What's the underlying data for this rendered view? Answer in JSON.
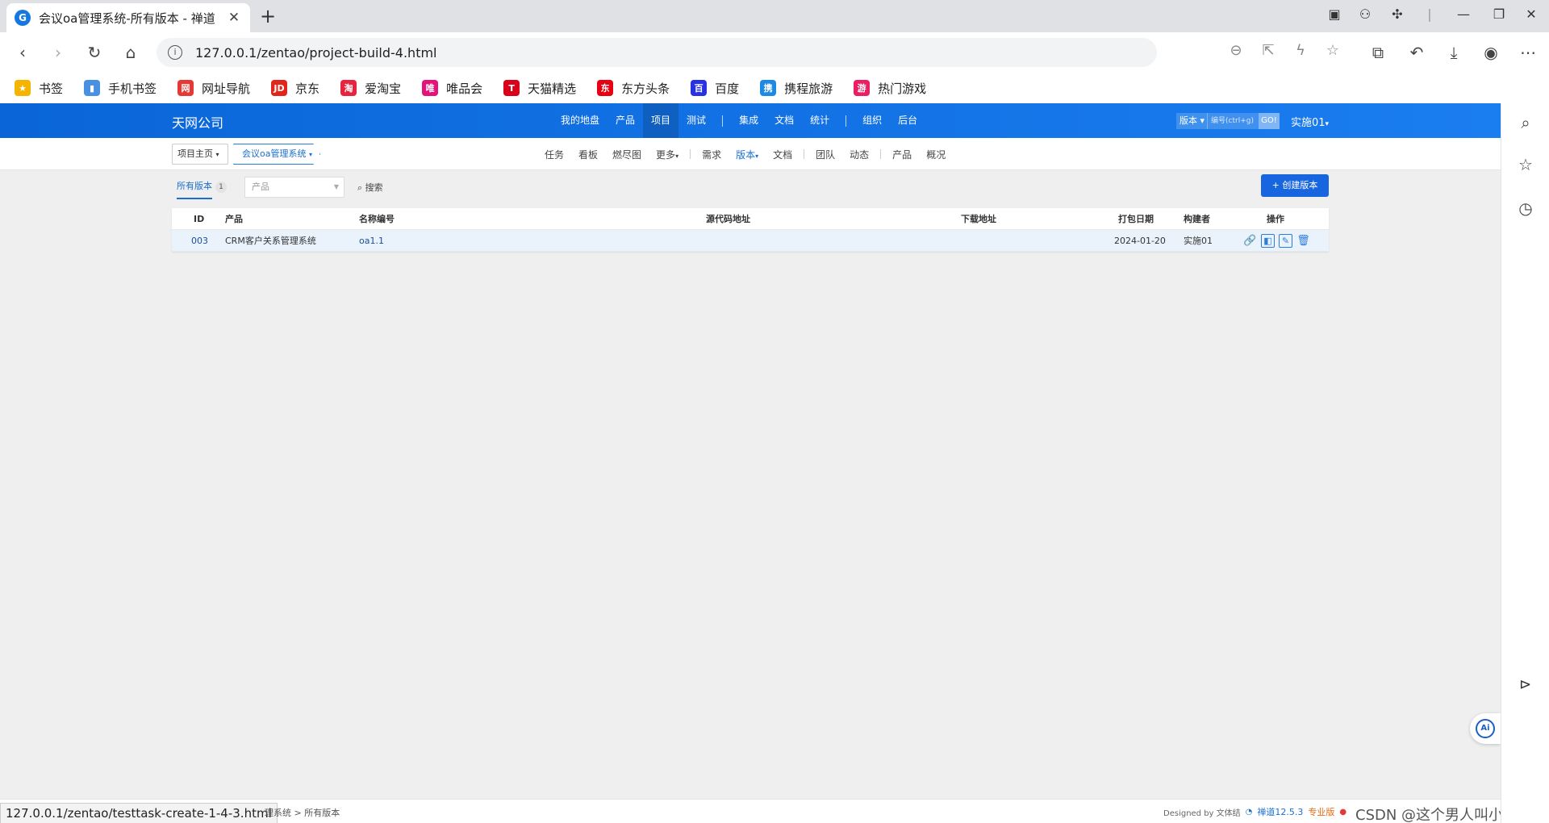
{
  "browser": {
    "tab_title": "会议oa管理系统-所有版本 - 禅道",
    "tab_close": "✕",
    "favicon_letter": "G",
    "new_tab": "+",
    "url": "127.0.0.1/zentao/project-build-4.html",
    "info_glyph": "i",
    "bookmarks": [
      {
        "label": "书签",
        "icon": "star-icon",
        "color": "#f5b400",
        "glyph": "★"
      },
      {
        "label": "手机书签",
        "icon": "phone-icon",
        "color": "#4a90e2",
        "glyph": "▮"
      },
      {
        "label": "网址导航",
        "icon": "nav-icon",
        "color": "#e53935",
        "glyph": "网"
      },
      {
        "label": "京东",
        "icon": "jd-icon",
        "color": "#e1251b",
        "glyph": "JD"
      },
      {
        "label": "爱淘宝",
        "icon": "taobao-icon",
        "color": "#e8233f",
        "glyph": "淘"
      },
      {
        "label": "唯品会",
        "icon": "vip-icon",
        "color": "#e2147a",
        "glyph": "唯"
      },
      {
        "label": "天猫精选",
        "icon": "tmall-icon",
        "color": "#d9001b",
        "glyph": "T"
      },
      {
        "label": "东方头条",
        "icon": "dongfang-icon",
        "color": "#e60012",
        "glyph": "东"
      },
      {
        "label": "百度",
        "icon": "baidu-icon",
        "color": "#2932e1",
        "glyph": "百"
      },
      {
        "label": "携程旅游",
        "icon": "ctrip-icon",
        "color": "#1e88e5",
        "glyph": "携"
      },
      {
        "label": "热门游戏",
        "icon": "game-icon",
        "color": "#e91e63",
        "glyph": "游"
      }
    ],
    "status_url": "127.0.0.1/zentao/testtask-create-1-4-3.html"
  },
  "app": {
    "company": "天网公司",
    "main_nav": [
      "我的地盘",
      "产品",
      "项目",
      "测试",
      "集成",
      "文档",
      "统计",
      "组织",
      "后台"
    ],
    "main_nav_active": "项目",
    "search_type": "版本",
    "search_caret": "▾",
    "search_placeholder": "编号(ctrl+g)",
    "search_go": "GO!",
    "user": "实施01",
    "user_caret": "▾",
    "crumb_home": "项目主页",
    "crumb_project": "会议oa管理系统",
    "crumb_caret": "▾",
    "sub_nav": [
      "任务",
      "看板",
      "燃尽图",
      "更多",
      "需求",
      "版本",
      "文档",
      "团队",
      "动态",
      "产品",
      "概况"
    ],
    "more_label": "更多",
    "sub_nav_active": "版本",
    "filter": {
      "tab_all": "所有版本",
      "count": "1",
      "product_placeholder": "产品",
      "search": "搜索",
      "create": "+ 创建版本"
    },
    "table": {
      "headers": {
        "id": "ID",
        "product": "产品",
        "name": "名称编号",
        "scm": "源代码地址",
        "download": "下载地址",
        "date": "打包日期",
        "builder": "构建者",
        "actions": "操作"
      },
      "rows": [
        {
          "id": "003",
          "product": "CRM客户关系管理系统",
          "name": "oa1.1",
          "scm": "",
          "download": "",
          "date": "2024-01-20",
          "builder": "实施01"
        }
      ]
    },
    "footer": {
      "crumb": "理系统 > 所有版本",
      "designed": "Designed by 文体结",
      "version": "禅道12.5.3",
      "edition": "专业版"
    }
  },
  "watermark": "CSDN @这个男人叫小帅&"
}
